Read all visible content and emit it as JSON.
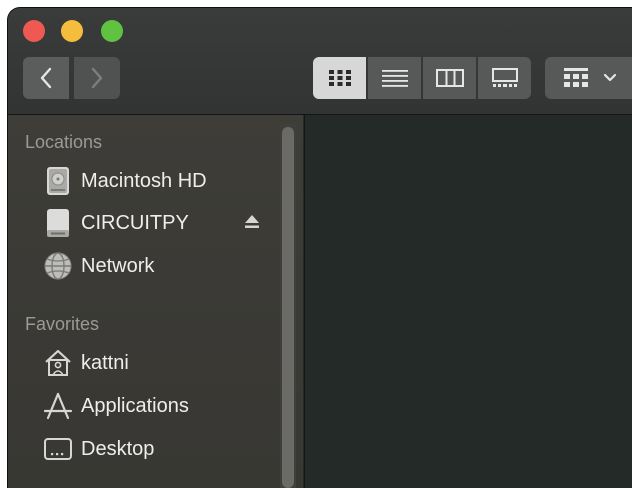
{
  "sidebar": {
    "locations_header": "Locations",
    "favorites_header": "Favorites",
    "locations": [
      {
        "label": "Macintosh HD",
        "icon": "hard-drive-icon"
      },
      {
        "label": "CIRCUITPY",
        "icon": "external-drive-icon"
      },
      {
        "label": "Network",
        "icon": "globe-icon"
      }
    ],
    "favorites": [
      {
        "label": "kattni",
        "icon": "home-icon"
      },
      {
        "label": "Applications",
        "icon": "applications-icon"
      },
      {
        "label": "Desktop",
        "icon": "desktop-icon"
      }
    ]
  },
  "toolbar": {
    "views": [
      {
        "name": "icon-view",
        "icon": "grid-icon",
        "active": true
      },
      {
        "name": "list-view",
        "icon": "list-icon",
        "active": false
      },
      {
        "name": "column-view",
        "icon": "columns-icon",
        "active": false
      },
      {
        "name": "gallery-view",
        "icon": "gallery-icon",
        "active": false
      }
    ]
  },
  "colors": {
    "window_bg": "#242a27",
    "sidebar_bg": "#3c3b37",
    "titlebar_bg": "#363837",
    "close": "#ee5a52",
    "minimize": "#f4bd3c",
    "zoom": "#5fc341",
    "label_text": "#eeeeec",
    "section_text": "#9b9a95"
  }
}
